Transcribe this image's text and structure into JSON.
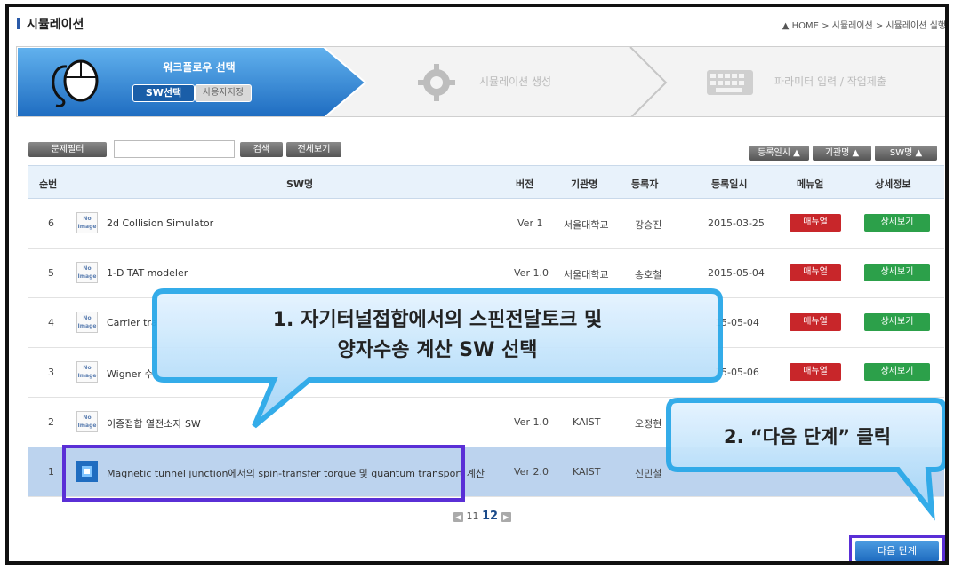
{
  "page": {
    "title": "시뮬레이션",
    "breadcrumb": "▲ HOME > 시뮬레이션 > 시뮬레이션 실행"
  },
  "wizard": {
    "step1_title": "워크플로우 선택",
    "sw_select": "SW선택",
    "user_spec": "사용자지정",
    "step2_label": "시뮬레이션 생성",
    "step3_label": "파라미터 입력 / 작업제출"
  },
  "toolbar": {
    "filter": "문제필터",
    "search": "검색",
    "view_all": "전체보기",
    "sort_date": "등록일시 ▲",
    "sort_org": "기관명 ▲",
    "sort_sw": "SW명 ▲"
  },
  "table": {
    "headers": {
      "no": "순번",
      "sw": "SW명",
      "version": "버전",
      "org": "기관명",
      "author": "등록자",
      "date": "등록일시",
      "manual": "메뉴얼",
      "detail": "상세정보"
    },
    "no_image": "No Image",
    "manual_label": "매뉴얼",
    "detail_label": "상세보기",
    "rows": [
      {
        "no": "6",
        "name": "2d Collision Simulator",
        "version": "Ver 1",
        "org": "서울대학교",
        "author": "강승진",
        "date": "2015-03-25"
      },
      {
        "no": "5",
        "name": "1-D TAT modeler",
        "version": "Ver 1.0",
        "org": "서울대학교",
        "author": "송호철",
        "date": "2015-05-04"
      },
      {
        "no": "4",
        "name": "Carrier tra",
        "version": "",
        "org": "",
        "author": "",
        "date": "15-05-04"
      },
      {
        "no": "3",
        "name": "Wigner 수",
        "version": "",
        "org": "",
        "author": "",
        "date": "15-05-06"
      },
      {
        "no": "2",
        "name": "이종접합 열전소자 SW",
        "version": "Ver 1.0",
        "org": "KAIST",
        "author": "오정현",
        "date": ""
      },
      {
        "no": "1",
        "name": "Magnetic tunnel junction에서의 spin-transfer torque 및 quantum transport 계산",
        "version": "Ver 2.0",
        "org": "KAIST",
        "author": "신민철",
        "date": ""
      }
    ]
  },
  "pager": {
    "prev": "11",
    "current": "12"
  },
  "next_button": "다음 단계",
  "callouts": {
    "one_line1": "1. 자기터널접합에서의 스핀전달토크 및",
    "one_line2": "양자수송 계산 SW 선택",
    "two": "2. “다음 단계” 클릭"
  },
  "colors": {
    "accent": "#2a7fd0",
    "highlight": "#5a2fd6",
    "manual": "#c8262a",
    "detail": "#2ca04a"
  }
}
